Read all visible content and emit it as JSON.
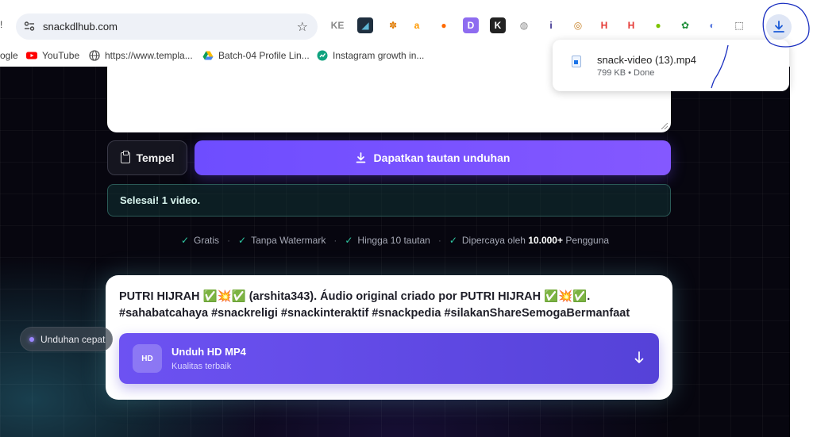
{
  "browser": {
    "url": "snackdlhub.com",
    "edge_glyph": "!",
    "bookmarks": [
      {
        "label": "ogle",
        "icon": "google-icon"
      },
      {
        "label": "YouTube",
        "icon": "youtube-icon"
      },
      {
        "label": "https://www.templa...",
        "icon": "globe-icon"
      },
      {
        "label": "Batch-04 Profile Lin...",
        "icon": "drive-icon"
      },
      {
        "label": "Instagram growth in...",
        "icon": "growth-icon"
      }
    ],
    "extensions": [
      {
        "glyph": "KE",
        "color": "#8a8a8a",
        "bg": "transparent"
      },
      {
        "glyph": "◢",
        "color": "#5fb7d6",
        "bg": "#1f2f3f"
      },
      {
        "glyph": "✽",
        "color": "#e07b00",
        "bg": "transparent"
      },
      {
        "glyph": "a",
        "color": "#ff9900",
        "bg": "transparent"
      },
      {
        "glyph": "●",
        "color": "#ff6a00",
        "bg": "transparent"
      },
      {
        "glyph": "D",
        "color": "#ffffff",
        "bg": "#8e6cf0"
      },
      {
        "glyph": "K",
        "color": "#ffffff",
        "bg": "#222222"
      },
      {
        "glyph": "◍",
        "color": "#888888",
        "bg": "transparent"
      },
      {
        "glyph": "i",
        "color": "#3a2f8f",
        "bg": "transparent"
      },
      {
        "glyph": "◎",
        "color": "#c57c1e",
        "bg": "transparent"
      },
      {
        "glyph": "H",
        "color": "#e53935",
        "bg": "transparent"
      },
      {
        "glyph": "H",
        "color": "#e53935",
        "bg": "transparent"
      },
      {
        "glyph": "●",
        "color": "#7cc300",
        "bg": "transparent"
      },
      {
        "glyph": "✿",
        "color": "#1f8f3a",
        "bg": "transparent"
      },
      {
        "glyph": "◐",
        "color": "#5b7be0",
        "bg": "transparent"
      },
      {
        "glyph": "⬚",
        "color": "#333333",
        "bg": "transparent"
      }
    ],
    "download": {
      "filename": "snack-video (13).mp4",
      "meta": "799 KB • Done"
    }
  },
  "page": {
    "paste_label": "Tempel",
    "get_label": "Dapatkan tautan unduhan",
    "status": "Selesai! 1 video.",
    "features": [
      {
        "text": "Gratis"
      },
      {
        "text": "Tanpa Watermark"
      },
      {
        "text": "Hingga 10 tautan"
      },
      {
        "text_pre": "Dipercaya oleh ",
        "bold": "10.000+",
        "text_post": " Pengguna"
      }
    ],
    "video_title": "PUTRI HIJRAH ✅💥✅ (arshita343). Áudio original criado por PUTRI HIJRAH ✅💥✅. #sahabatcahaya #snackreligi #snackinteraktif #snackpedia #silakanShareSemogaBermanfaat",
    "hd": {
      "badge": "HD",
      "title": "Unduh HD MP4",
      "subtitle": "Kualitas terbaik"
    },
    "quick_label": "Unduhan cepat"
  },
  "colors": {
    "accent": "#6e4dff",
    "status_green": "#2fc7a2",
    "annotation": "#1a2fc0"
  }
}
